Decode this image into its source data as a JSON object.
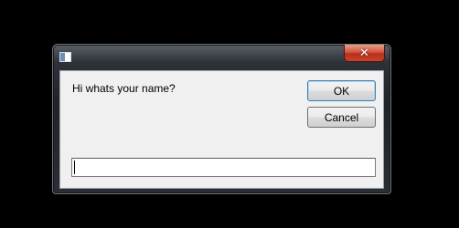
{
  "dialog": {
    "title": "",
    "icon": "window-icon",
    "close_label": "✕",
    "prompt": "Hi whats your name?",
    "ok_label": "OK",
    "cancel_label": "Cancel",
    "input_value": "",
    "accent_color": "#3c7fb1",
    "close_color": "#c8452b"
  }
}
